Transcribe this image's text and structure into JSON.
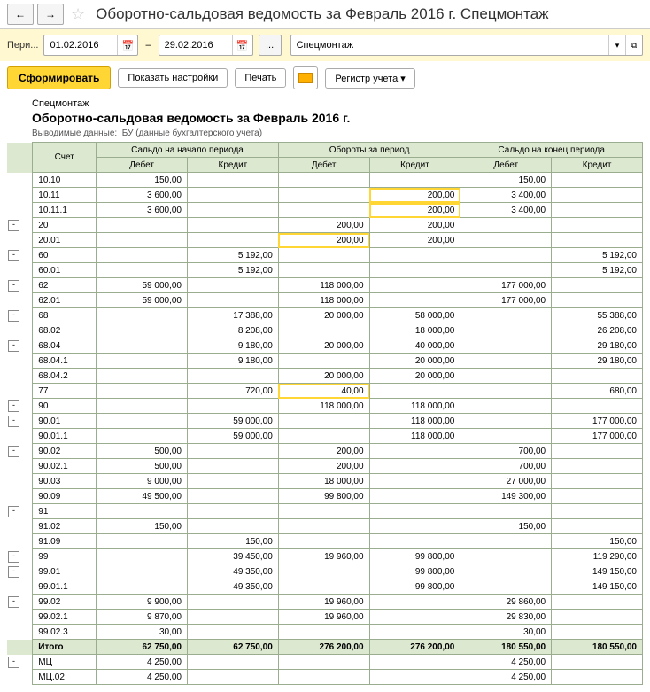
{
  "header": {
    "title": "Оборотно-сальдовая ведомость за Февраль 2016 г. Спецмонтаж"
  },
  "filter": {
    "period_label": "Пери...",
    "date_from": "01.02.2016",
    "date_to": "29.02.2016",
    "dash": "–",
    "dots": "...",
    "org": "Спецмонтаж"
  },
  "toolbar": {
    "form": "Сформировать",
    "settings": "Показать настройки",
    "print": "Печать",
    "register": "Регистр учета"
  },
  "report": {
    "org": "Спецмонтаж",
    "title": "Оборотно-сальдовая ведомость за Февраль 2016 г.",
    "subtitle_label": "Выводимые данные:",
    "subtitle_value": "БУ (данные бухгалтерского учета)"
  },
  "columns": {
    "account": "Счет",
    "start": "Сальдо на начало периода",
    "turn": "Обороты за период",
    "end": "Сальдо на конец периода",
    "debit": "Дебет",
    "credit": "Кредит"
  },
  "rows": [
    {
      "tree": "",
      "acct": "10.10",
      "sd": "150,00",
      "sc": "",
      "td": "",
      "tc": "",
      "ed": "150,00",
      "ec": ""
    },
    {
      "tree": "",
      "acct": "10.11",
      "sd": "3 600,00",
      "sc": "",
      "td": "",
      "tc": "200,00",
      "ed": "3 400,00",
      "ec": "",
      "hl_tc": true
    },
    {
      "tree": "",
      "acct": "10.11.1",
      "sd": "3 600,00",
      "sc": "",
      "td": "",
      "tc": "200,00",
      "ed": "3 400,00",
      "ec": "",
      "hl_tc": true
    },
    {
      "tree": "-",
      "acct": "20",
      "sd": "",
      "sc": "",
      "td": "200,00",
      "tc": "200,00",
      "ed": "",
      "ec": ""
    },
    {
      "tree": "",
      "acct": "20.01",
      "sd": "",
      "sc": "",
      "td": "200,00",
      "tc": "200,00",
      "ed": "",
      "ec": "",
      "hl_td": true
    },
    {
      "tree": "-",
      "acct": "60",
      "sd": "",
      "sc": "5 192,00",
      "td": "",
      "tc": "",
      "ed": "",
      "ec": "5 192,00"
    },
    {
      "tree": "",
      "acct": "60.01",
      "sd": "",
      "sc": "5 192,00",
      "td": "",
      "tc": "",
      "ed": "",
      "ec": "5 192,00"
    },
    {
      "tree": "-",
      "acct": "62",
      "sd": "59 000,00",
      "sc": "",
      "td": "118 000,00",
      "tc": "",
      "ed": "177 000,00",
      "ec": ""
    },
    {
      "tree": "",
      "acct": "62.01",
      "sd": "59 000,00",
      "sc": "",
      "td": "118 000,00",
      "tc": "",
      "ed": "177 000,00",
      "ec": ""
    },
    {
      "tree": "-",
      "acct": "68",
      "sd": "",
      "sc": "17 388,00",
      "td": "20 000,00",
      "tc": "58 000,00",
      "ed": "",
      "ec": "55 388,00"
    },
    {
      "tree": "",
      "acct": "68.02",
      "sd": "",
      "sc": "8 208,00",
      "td": "",
      "tc": "18 000,00",
      "ed": "",
      "ec": "26 208,00"
    },
    {
      "tree": "-",
      "acct": "68.04",
      "sd": "",
      "sc": "9 180,00",
      "td": "20 000,00",
      "tc": "40 000,00",
      "ed": "",
      "ec": "29 180,00"
    },
    {
      "tree": "",
      "acct": "68.04.1",
      "sd": "",
      "sc": "9 180,00",
      "td": "",
      "tc": "20 000,00",
      "ed": "",
      "ec": "29 180,00"
    },
    {
      "tree": "",
      "acct": "68.04.2",
      "sd": "",
      "sc": "",
      "td": "20 000,00",
      "tc": "20 000,00",
      "ed": "",
      "ec": ""
    },
    {
      "tree": "",
      "acct": "77",
      "sd": "",
      "sc": "720,00",
      "td": "40,00",
      "tc": "",
      "ed": "",
      "ec": "680,00",
      "hl_td": true
    },
    {
      "tree": "-",
      "acct": "90",
      "sd": "",
      "sc": "",
      "td": "118 000,00",
      "tc": "118 000,00",
      "ed": "",
      "ec": ""
    },
    {
      "tree": "-",
      "acct": "90.01",
      "sd": "",
      "sc": "59 000,00",
      "td": "",
      "tc": "118 000,00",
      "ed": "",
      "ec": "177 000,00"
    },
    {
      "tree": "",
      "acct": "90.01.1",
      "sd": "",
      "sc": "59 000,00",
      "td": "",
      "tc": "118 000,00",
      "ed": "",
      "ec": "177 000,00"
    },
    {
      "tree": "-",
      "acct": "90.02",
      "sd": "500,00",
      "sc": "",
      "td": "200,00",
      "tc": "",
      "ed": "700,00",
      "ec": ""
    },
    {
      "tree": "",
      "acct": "90.02.1",
      "sd": "500,00",
      "sc": "",
      "td": "200,00",
      "tc": "",
      "ed": "700,00",
      "ec": ""
    },
    {
      "tree": "",
      "acct": "90.03",
      "sd": "9 000,00",
      "sc": "",
      "td": "18 000,00",
      "tc": "",
      "ed": "27 000,00",
      "ec": ""
    },
    {
      "tree": "",
      "acct": "90.09",
      "sd": "49 500,00",
      "sc": "",
      "td": "99 800,00",
      "tc": "",
      "ed": "149 300,00",
      "ec": ""
    },
    {
      "tree": "-",
      "acct": "91",
      "sd": "",
      "sc": "",
      "td": "",
      "tc": "",
      "ed": "",
      "ec": ""
    },
    {
      "tree": "",
      "acct": "91.02",
      "sd": "150,00",
      "sc": "",
      "td": "",
      "tc": "",
      "ed": "150,00",
      "ec": ""
    },
    {
      "tree": "",
      "acct": "91.09",
      "sd": "",
      "sc": "150,00",
      "td": "",
      "tc": "",
      "ed": "",
      "ec": "150,00"
    },
    {
      "tree": "-",
      "acct": "99",
      "sd": "",
      "sc": "39 450,00",
      "td": "19 960,00",
      "tc": "99 800,00",
      "ed": "",
      "ec": "119 290,00"
    },
    {
      "tree": "-",
      "acct": "99.01",
      "sd": "",
      "sc": "49 350,00",
      "td": "",
      "tc": "99 800,00",
      "ed": "",
      "ec": "149 150,00"
    },
    {
      "tree": "",
      "acct": "99.01.1",
      "sd": "",
      "sc": "49 350,00",
      "td": "",
      "tc": "99 800,00",
      "ed": "",
      "ec": "149 150,00"
    },
    {
      "tree": "-",
      "acct": "99.02",
      "sd": "9 900,00",
      "sc": "",
      "td": "19 960,00",
      "tc": "",
      "ed": "29 860,00",
      "ec": ""
    },
    {
      "tree": "",
      "acct": "99.02.1",
      "sd": "9 870,00",
      "sc": "",
      "td": "19 960,00",
      "tc": "",
      "ed": "29 830,00",
      "ec": ""
    },
    {
      "tree": "",
      "acct": "99.02.3",
      "sd": "30,00",
      "sc": "",
      "td": "",
      "tc": "",
      "ed": "30,00",
      "ec": ""
    }
  ],
  "total": {
    "label": "Итого",
    "sd": "62 750,00",
    "sc": "62 750,00",
    "td": "276 200,00",
    "tc": "276 200,00",
    "ed": "180 550,00",
    "ec": "180 550,00"
  },
  "extra_rows": [
    {
      "tree": "-",
      "acct": "МЦ",
      "sd": "4 250,00",
      "sc": "",
      "td": "",
      "tc": "",
      "ed": "4 250,00",
      "ec": ""
    },
    {
      "tree": "",
      "acct": "МЦ.02",
      "sd": "4 250,00",
      "sc": "",
      "td": "",
      "tc": "",
      "ed": "4 250,00",
      "ec": ""
    }
  ]
}
